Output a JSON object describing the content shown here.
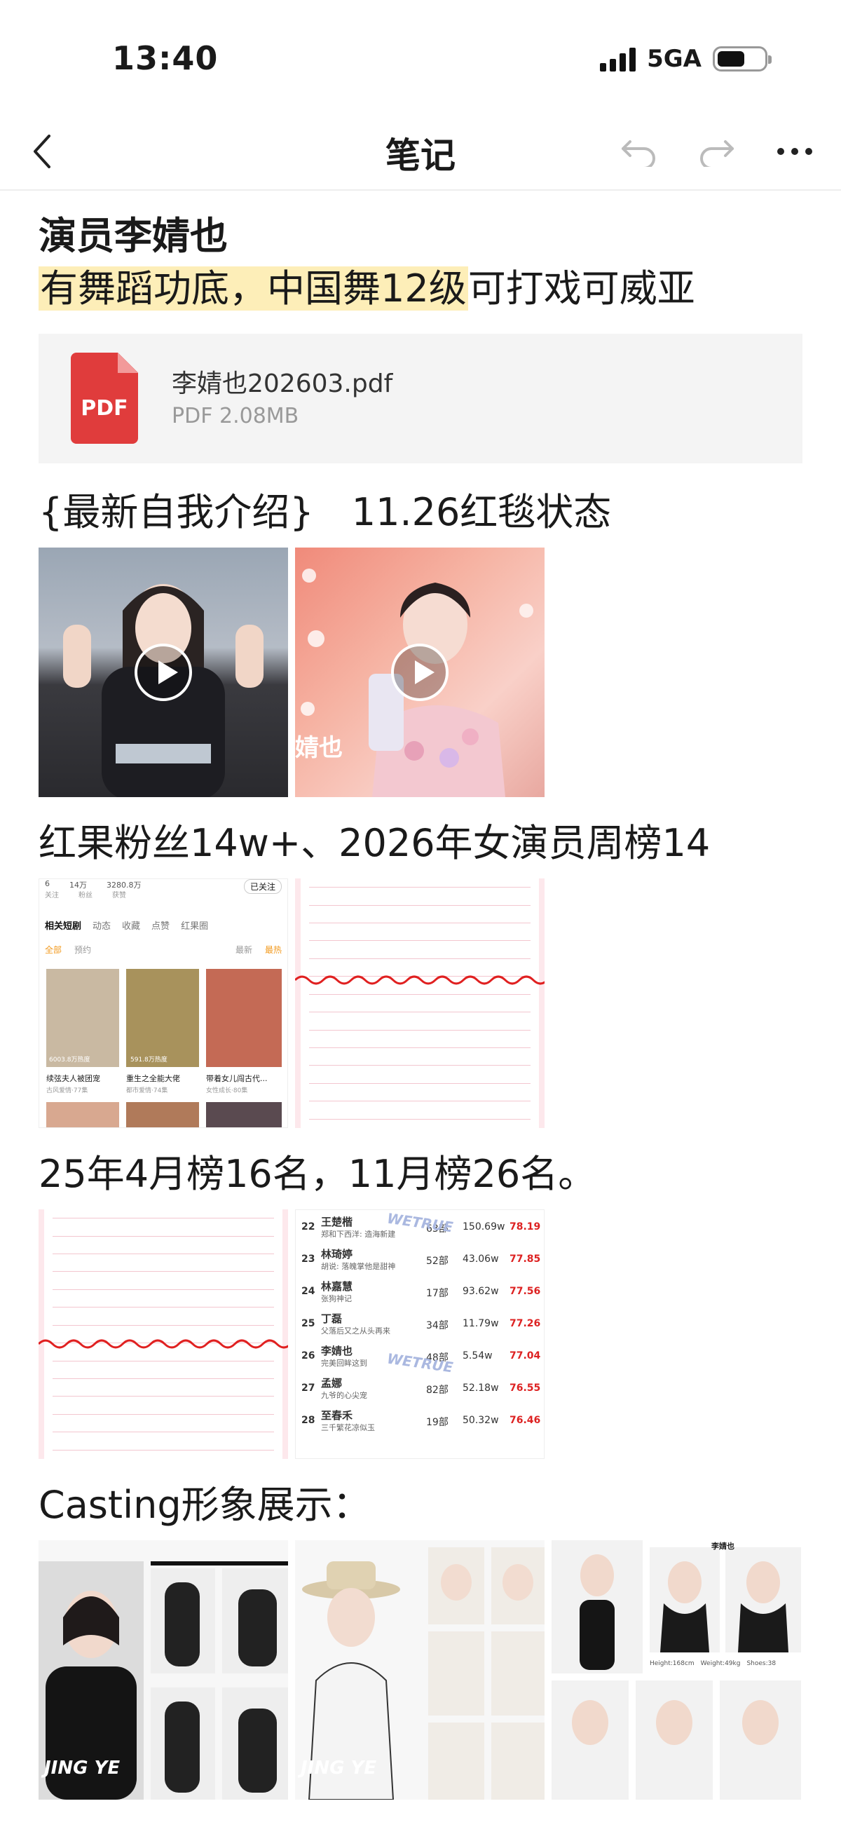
{
  "status_bar": {
    "time": "13:40",
    "network": "5GA"
  },
  "nav": {
    "title": "笔记"
  },
  "note": {
    "heading": "演员李婧也",
    "intro_highlight": "有舞蹈功底，中国舞12级",
    "intro_rest": "可打戏可威亚",
    "attachment": {
      "icon_label": "PDF",
      "name": "李婧也202603.pdf",
      "meta": "PDF 2.08MB"
    },
    "section1": "{最新自我介绍}　11.26红毯状态",
    "video1_caption": "婧也",
    "section2": "红果粉丝14w+、2026年女演员周榜14",
    "section3": "25年4月榜16名，11月榜26名。",
    "section4": "Casting形象展示：",
    "profile_card": {
      "stats": [
        "6",
        "14万",
        "3280.8万"
      ],
      "stat_labels": [
        "关注",
        "粉丝",
        "获赞"
      ],
      "follow": "已关注",
      "tabs": [
        "相关短剧",
        "动态",
        "收藏",
        "点赞",
        "红果圈"
      ],
      "filters": [
        "全部",
        "预约"
      ],
      "sort": [
        "最新",
        "最热"
      ],
      "dramas": [
        {
          "title": "续弦夫人被团宠",
          "meta": "古风爱情·77集",
          "heat": "6003.8万热度"
        },
        {
          "title": "重生之全能大佬",
          "meta": "都市爱情·74集",
          "heat": "591.8万热度"
        },
        {
          "title": "带着女儿闯古代...",
          "meta": "女性成长·80集",
          "heat": ""
        }
      ]
    },
    "ranking": [
      {
        "rank": "22",
        "name": "王楚楷",
        "sub": "郑和下西洋: 造海新建",
        "works": "63部",
        "views": "150.69w",
        "score": "78.19"
      },
      {
        "rank": "23",
        "name": "林琦婷",
        "sub": "胡说: 落魄掌他是甜神",
        "works": "52部",
        "views": "43.06w",
        "score": "77.85"
      },
      {
        "rank": "24",
        "name": "林嘉慧",
        "sub": "张狗神记",
        "works": "17部",
        "views": "93.62w",
        "score": "77.56"
      },
      {
        "rank": "25",
        "name": "丁磊",
        "sub": "父落后又之从头再来",
        "works": "34部",
        "views": "11.79w",
        "score": "77.26"
      },
      {
        "rank": "26",
        "name": "李婧也",
        "sub": "完美回眸这到",
        "works": "48部",
        "views": "5.54w",
        "score": "77.04"
      },
      {
        "rank": "27",
        "name": "孟娜",
        "sub": "九爷的心尖宠",
        "works": "82部",
        "views": "52.18w",
        "score": "76.55"
      },
      {
        "rank": "28",
        "name": "至春禾",
        "sub": "三千繁花凉似玉",
        "works": "19部",
        "views": "50.32w",
        "score": "76.46"
      }
    ],
    "watermark": "WETRUE",
    "casting_watermark": "JING YE",
    "casting_card_name": "李婧也",
    "casting_measure": "Height:168cm　Weight:49kg　Shoes:38"
  }
}
